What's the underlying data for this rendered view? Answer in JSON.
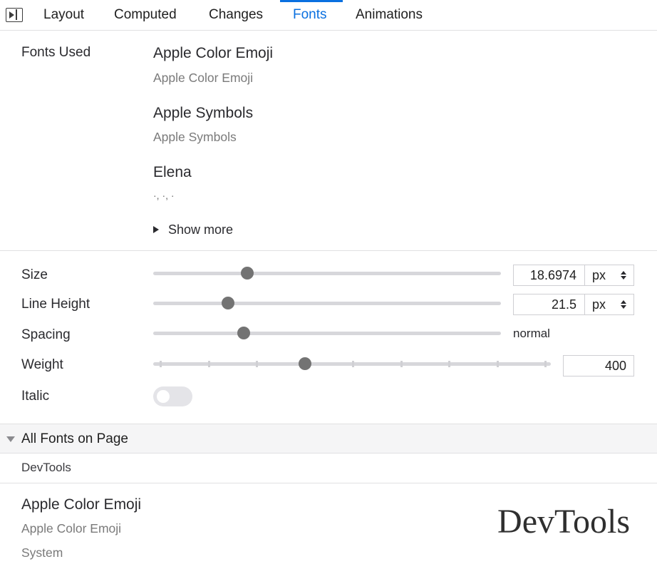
{
  "tabs": [
    {
      "label": "Layout"
    },
    {
      "label": "Computed"
    },
    {
      "label": "Changes"
    },
    {
      "label": "Fonts",
      "active": true
    },
    {
      "label": "Animations"
    }
  ],
  "fonts_used": {
    "label": "Fonts Used",
    "fonts": [
      {
        "name": "Apple Color Emoji",
        "source": "Apple Color Emoji"
      },
      {
        "name": "Apple Symbols",
        "source": "Apple Symbols"
      },
      {
        "name": "Elena",
        "source": "·, ·, ·"
      }
    ],
    "show_more": "Show more"
  },
  "editor": {
    "size": {
      "label": "Size",
      "value": "18.6974",
      "unit": "px",
      "slider_fraction": 0.27
    },
    "line_height": {
      "label": "Line Height",
      "value": "21.5",
      "unit": "px",
      "slider_fraction": 0.215
    },
    "spacing": {
      "label": "Spacing",
      "value": "normal",
      "slider_fraction": 0.26
    },
    "weight": {
      "label": "Weight",
      "value": "400",
      "min": 100,
      "max": 900,
      "step": 100
    },
    "italic": {
      "label": "Italic",
      "enabled": false
    }
  },
  "all_fonts": {
    "header": "All Fonts on Page",
    "origin": "DevTools",
    "font": {
      "name": "Apple Color Emoji",
      "source": "Apple Color Emoji",
      "origin": "System",
      "preview": "DevTools"
    }
  },
  "colors": {
    "accent": "#0a70e0",
    "thumb": "#737373"
  }
}
